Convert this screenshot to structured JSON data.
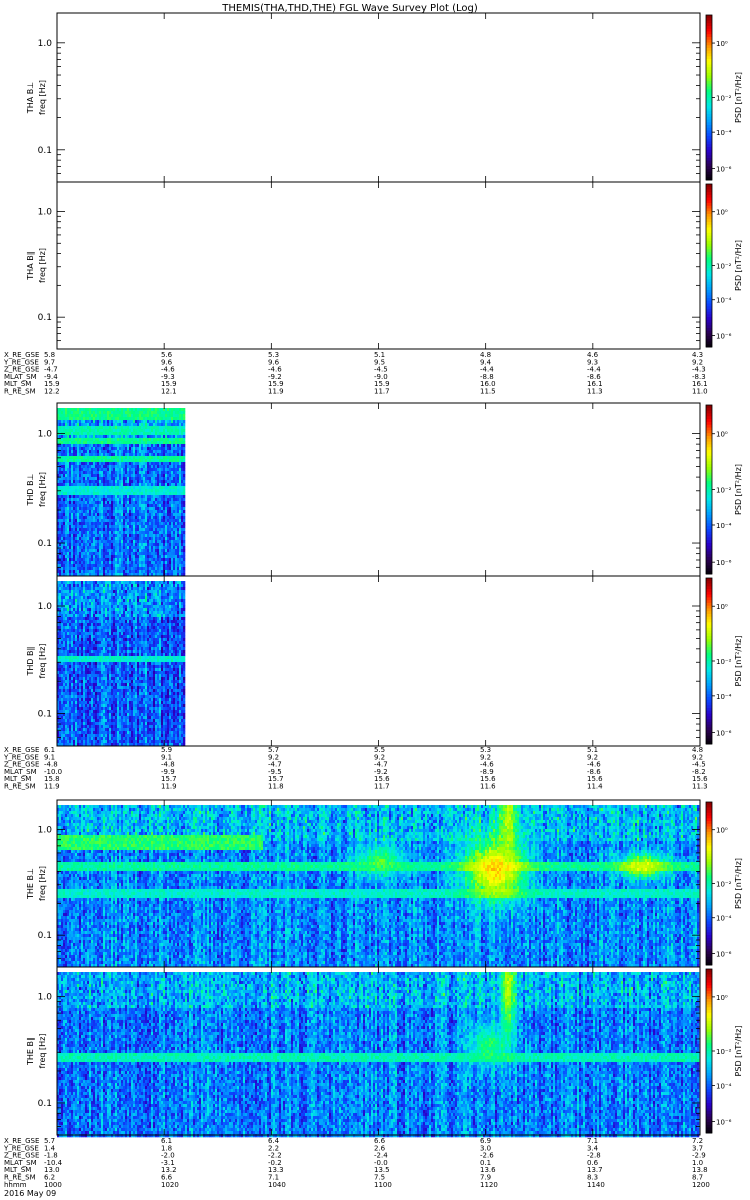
{
  "title": "THEMIS(THA,THD,THE) FGL Wave Survey Plot (Log)",
  "colorbar_label": "PSD [nT²/Hz]",
  "colorbar_ticks": [
    "10⁰",
    "10⁻²",
    "10⁻⁴",
    "10⁻⁶"
  ],
  "colormap": [
    "#000000",
    "#2b0050",
    "#2a00c8",
    "#0a46ff",
    "#00a0ff",
    "#00e8e8",
    "#00ff80",
    "#9aff00",
    "#ffff00",
    "#ff9600",
    "#ff0000",
    "#8b0000"
  ],
  "freq_ticks": [
    "1.0",
    "0.1"
  ],
  "chart_data": [
    {
      "type": "heatmap",
      "id": "tha-bperp",
      "probe": "THA",
      "ylabel_top": "THA B⊥",
      "ylabel_bottom": "freq [Hz]",
      "yscale": "log",
      "ylim": [
        0.05,
        1.9
      ],
      "data_time_range": null,
      "note": "no data"
    },
    {
      "type": "heatmap",
      "id": "tha-bpar",
      "probe": "THA",
      "ylabel_top": "THA B∥",
      "ylabel_bottom": "freq [Hz]",
      "yscale": "log",
      "ylim": [
        0.05,
        1.9
      ],
      "data_time_range": null
    },
    {
      "type": "heatmap",
      "id": "thd-bperp",
      "probe": "THD",
      "ylabel_top": "THD B⊥",
      "ylabel_bottom": "freq [Hz]",
      "yscale": "log",
      "ylim": [
        0.05,
        1.9
      ],
      "data_time_range": [
        0,
        0.2
      ],
      "seed": 11,
      "base_level": 3.2,
      "features": [
        {
          "type": "band",
          "f": 1.5,
          "width": 0.05,
          "level": 5.4
        },
        {
          "type": "band",
          "f": 1.05,
          "width": 0.04,
          "level": 5.0
        },
        {
          "type": "band",
          "f": 0.85,
          "width": 0.03,
          "level": 5.3
        },
        {
          "type": "band",
          "f": 0.6,
          "width": 0.03,
          "level": 5.2
        },
        {
          "type": "band",
          "f": 0.3,
          "width": 0.04,
          "level": 4.7
        }
      ]
    },
    {
      "type": "heatmap",
      "id": "thd-bpar",
      "probe": "THD",
      "ylabel_top": "THD B∥",
      "ylabel_bottom": "freq [Hz]",
      "yscale": "log",
      "ylim": [
        0.05,
        1.9
      ],
      "data_time_range": [
        0,
        0.2
      ],
      "seed": 23,
      "base_level": 3.0,
      "features": [
        {
          "type": "band",
          "f": 0.32,
          "width": 0.03,
          "level": 4.8
        }
      ]
    },
    {
      "type": "heatmap",
      "id": "the-bperp",
      "probe": "THE",
      "ylabel_top": "THE B⊥",
      "ylabel_bottom": "freq [Hz]",
      "yscale": "log",
      "ylim": [
        0.05,
        1.9
      ],
      "data_time_range": [
        0,
        1
      ],
      "seed": 37,
      "base_level": 3.4,
      "features": [
        {
          "type": "band",
          "f": 0.45,
          "width": 0.05,
          "level": 5.2
        },
        {
          "type": "band",
          "f": 0.25,
          "width": 0.04,
          "level": 4.8
        },
        {
          "type": "band",
          "f": 0.75,
          "width": 0.08,
          "level": 5.6,
          "t0": 0.0,
          "t1": 0.32
        },
        {
          "type": "blob",
          "t": 0.68,
          "tw": 0.05,
          "f": 0.42,
          "fw": 0.3,
          "level": 7.6
        },
        {
          "type": "blob",
          "t": 0.7,
          "tw": 0.015,
          "f": 1.2,
          "fw": 0.5,
          "level": 6.6
        },
        {
          "type": "blob",
          "t": 0.91,
          "tw": 0.04,
          "f": 0.45,
          "fw": 0.12,
          "level": 7.0
        },
        {
          "type": "blob",
          "t": 0.5,
          "tw": 0.04,
          "f": 0.5,
          "fw": 0.15,
          "level": 5.8
        }
      ]
    },
    {
      "type": "heatmap",
      "id": "the-bpar",
      "probe": "THE",
      "ylabel_top": "THE B∥",
      "ylabel_bottom": "freq [Hz]",
      "yscale": "log",
      "ylim": [
        0.05,
        1.9
      ],
      "data_time_range": [
        0,
        1
      ],
      "seed": 53,
      "base_level": 3.3,
      "features": [
        {
          "type": "band",
          "f": 0.27,
          "width": 0.04,
          "level": 5.0
        },
        {
          "type": "blob",
          "t": 0.7,
          "tw": 0.012,
          "f": 1.2,
          "fw": 0.55,
          "level": 6.6
        },
        {
          "type": "blob",
          "t": 0.67,
          "tw": 0.03,
          "f": 0.35,
          "fw": 0.2,
          "level": 5.6
        }
      ]
    }
  ],
  "ephemeris_blocks": [
    {
      "id": "tha-ephem",
      "labels": [
        "X_RE_GSE",
        "Y_RE_GSE",
        "Z_RE_GSE",
        "MLAT_SM",
        "MLT_SM",
        "R_RE_SM"
      ],
      "columns": [
        [
          "5.8",
          "9.7",
          "-4.7",
          "-9.4",
          "15.9",
          "12.2"
        ],
        [
          "5.6",
          "9.6",
          "-4.6",
          "-9.3",
          "15.9",
          "12.1"
        ],
        [
          "5.3",
          "9.6",
          "-4.6",
          "-9.2",
          "15.9",
          "11.9"
        ],
        [
          "5.1",
          "9.5",
          "-4.5",
          "-9.0",
          "15.9",
          "11.7"
        ],
        [
          "4.8",
          "9.4",
          "-4.4",
          "-8.8",
          "16.0",
          "11.5"
        ],
        [
          "4.6",
          "9.3",
          "-4.4",
          "-8.6",
          "16.1",
          "11.3"
        ],
        [
          "4.3",
          "9.2",
          "-4.3",
          "-8.3",
          "16.1",
          "11.0"
        ]
      ]
    },
    {
      "id": "thd-ephem",
      "labels": [
        "X_RE_GSE",
        "Y_RE_GSE",
        "Z_RE_GSE",
        "MLAT_SM",
        "MLT_SM",
        "R_RE_SM"
      ],
      "columns": [
        [
          "6.1",
          "9.1",
          "-4.8",
          "-10.0",
          "15.8",
          "11.9"
        ],
        [
          "5.9",
          "9.1",
          "-4.8",
          "-9.9",
          "15.7",
          "11.9"
        ],
        [
          "5.7",
          "9.2",
          "-4.7",
          "-9.5",
          "15.7",
          "11.8"
        ],
        [
          "5.5",
          "9.2",
          "-4.7",
          "-9.2",
          "15.6",
          "11.7"
        ],
        [
          "5.3",
          "9.2",
          "-4.6",
          "-8.9",
          "15.6",
          "11.6"
        ],
        [
          "5.1",
          "9.2",
          "-4.6",
          "-8.6",
          "15.6",
          "11.4"
        ],
        [
          "4.8",
          "9.2",
          "-4.5",
          "-8.2",
          "15.6",
          "11.3"
        ]
      ]
    },
    {
      "id": "the-ephem",
      "labels": [
        "X_RE_GSE",
        "Y_RE_GSE",
        "Z_RE_GSE",
        "MLAT_SM",
        "MLT_SM",
        "R_RE_SM",
        "hhmm"
      ],
      "columns": [
        [
          "5.7",
          "1.4",
          "-1.8",
          "-10.4",
          "13.0",
          "6.2",
          "1000"
        ],
        [
          "6.1",
          "1.8",
          "-2.0",
          "-3.1",
          "13.2",
          "6.6",
          "1020"
        ],
        [
          "6.4",
          "2.2",
          "-2.2",
          "-0.2",
          "13.3",
          "7.1",
          "1040"
        ],
        [
          "6.6",
          "2.6",
          "-2.4",
          "-0.0",
          "13.5",
          "7.5",
          "1100"
        ],
        [
          "6.9",
          "3.0",
          "-2.6",
          "0.1",
          "13.6",
          "7.9",
          "1120"
        ],
        [
          "7.1",
          "3.4",
          "-2.8",
          "0.6",
          "13.7",
          "8.3",
          "1140"
        ],
        [
          "7.2",
          "3.7",
          "-2.9",
          "1.0",
          "13.8",
          "8.7",
          "1200"
        ]
      ]
    }
  ],
  "date_label": "2016 May 09"
}
